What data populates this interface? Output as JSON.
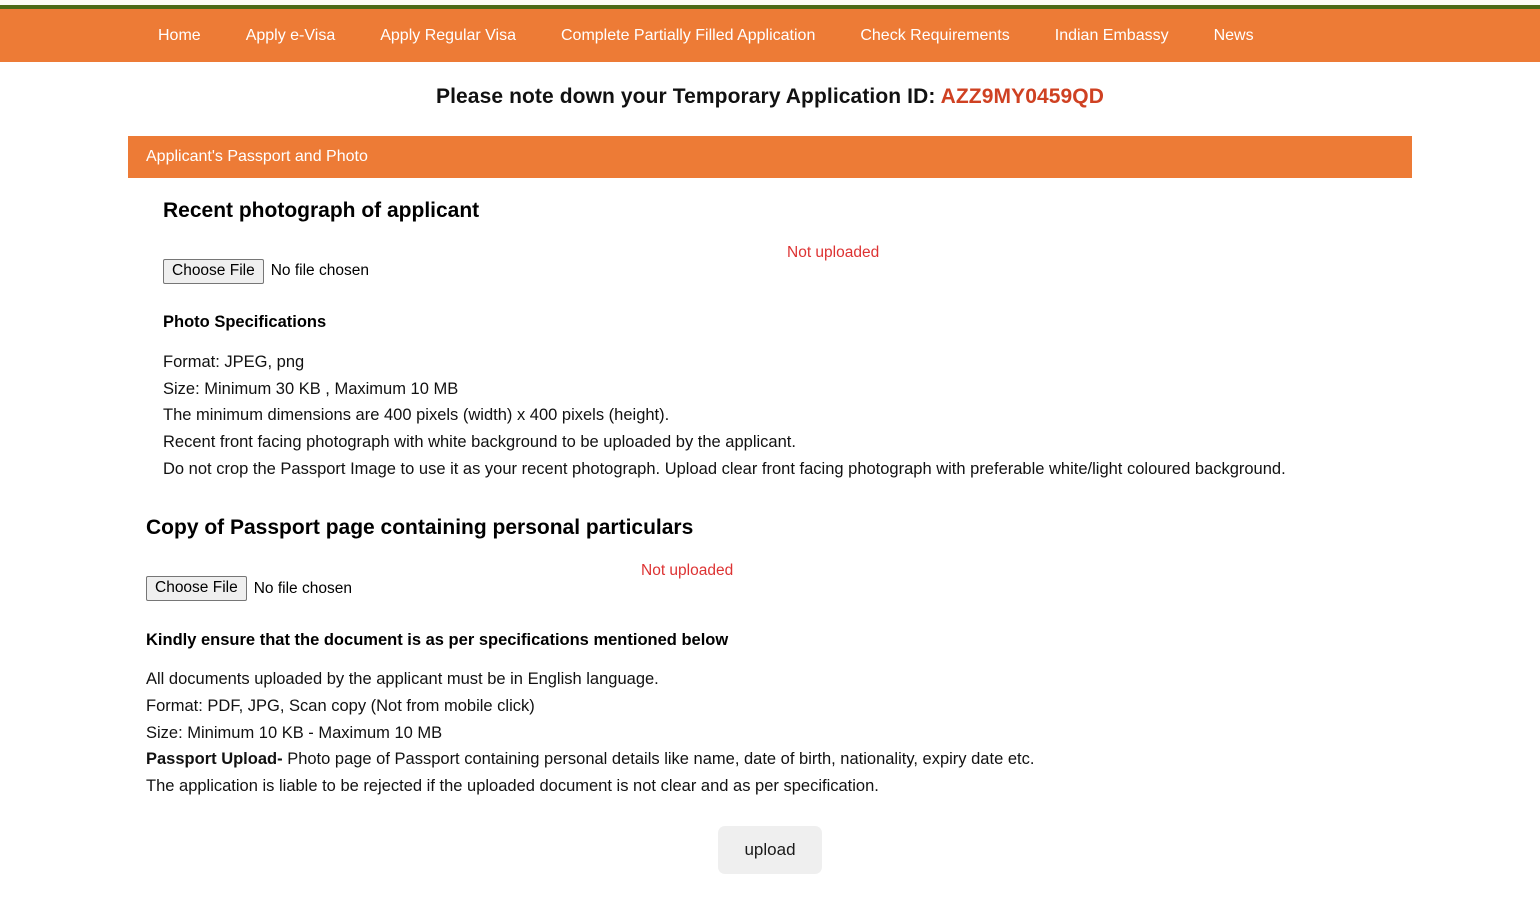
{
  "theme": {
    "orange": "#ed7b36",
    "green_rule": "#4b6b12",
    "cream_strip": "#fbfdf2",
    "id_red": "#cf4122",
    "status_red": "#dd3333"
  },
  "nav": {
    "items": [
      {
        "label": "Home",
        "name": "nav-home"
      },
      {
        "label": "Apply e-Visa",
        "name": "nav-apply-evisa"
      },
      {
        "label": "Apply Regular Visa",
        "name": "nav-apply-regular-visa"
      },
      {
        "label": "Complete Partially Filled Application",
        "name": "nav-complete-partially-filled-application"
      },
      {
        "label": "Check Requirements",
        "name": "nav-check-requirements"
      },
      {
        "label": "Indian Embassy",
        "name": "nav-indian-embassy"
      },
      {
        "label": "News",
        "name": "nav-news"
      }
    ]
  },
  "temp_id": {
    "prefix": "Please note down your Temporary Application ID: ",
    "value": "AZZ9MY0459QD"
  },
  "section": {
    "title": "Applicant's Passport and Photo"
  },
  "photo": {
    "heading": "Recent photograph of applicant",
    "choose_label": "Choose File",
    "file_name": "No file chosen",
    "status": "Not uploaded",
    "spec_title": "Photo Specifications",
    "spec_lines": [
      "Format: JPEG, png",
      "Size: Minimum 30 KB , Maximum 10 MB",
      "The minimum dimensions are 400 pixels (width) x 400 pixels (height).",
      "Recent front facing photograph with white background to be uploaded by the applicant.",
      "Do not crop the Passport Image to use it as your recent photograph. Upload clear front facing photograph with preferable white/light coloured background."
    ]
  },
  "passport": {
    "heading": "Copy of Passport page containing personal particulars",
    "choose_label": "Choose File",
    "file_name": "No file chosen",
    "status": "Not uploaded",
    "spec_title": "Kindly ensure that the document is as per specifications mentioned below",
    "spec_lines": [
      "All documents uploaded by the applicant must be in English language.",
      "Format: PDF, JPG, Scan copy (Not from mobile click)",
      "Size: Minimum 10 KB - Maximum 10 MB"
    ],
    "upload_line_emph": "Passport Upload-",
    "upload_line_rest": " Photo page of Passport containing personal details like name, date of birth, nationality, expiry date etc.",
    "reject_line": "The application is liable to be rejected if the uploaded document is not clear and as per specification."
  },
  "actions": {
    "upload_label": "upload"
  }
}
